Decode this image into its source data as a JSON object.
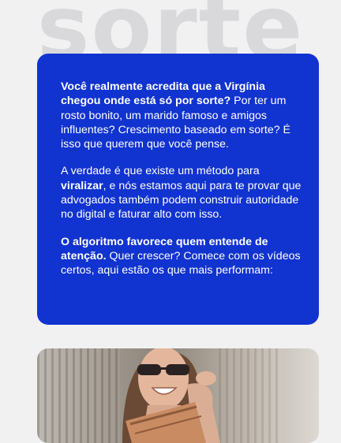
{
  "background_word": "sorte",
  "card": {
    "paragraphs": [
      {
        "bold": "Você realmente acredita que a Virgínia chegou onde está só por sorte?",
        "text": " Por ter um rosto bonito, um marido famoso e amigos influentes? Crescimento baseado em sorte? É isso que querem que você pense."
      },
      {
        "pre": "A verdade é que existe um método para ",
        "bold": "viralizar",
        "text": ", e nós estamos aqui para te provar que advogados também podem construir autoridade no digital e faturar alto com isso."
      },
      {
        "bold": "O algoritmo favorece quem entende de atenção.",
        "text": " Quer crescer? Comece com os vídeos certos, aqui estão os que mais performam:"
      }
    ]
  },
  "colors": {
    "card_background": "#1133cf",
    "page_background": "#f1f1f2",
    "background_word": "#d9d9dc"
  },
  "photo": {
    "icon": "person-photo-icon"
  }
}
